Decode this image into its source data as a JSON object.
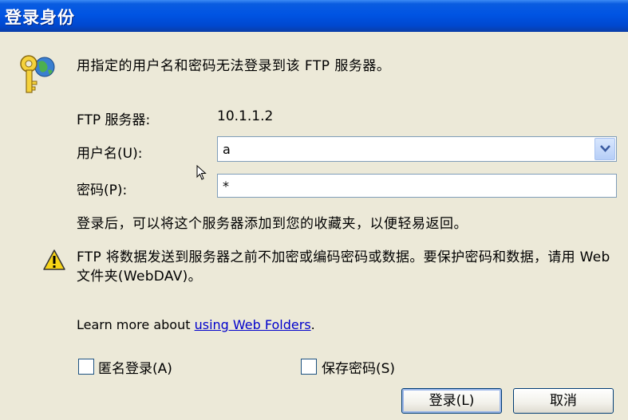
{
  "window": {
    "title": "登录身份"
  },
  "message": "用指定的用户名和密码无法登录到该 FTP 服务器。",
  "server": {
    "label": "FTP 服务器:",
    "value": "10.1.1.2"
  },
  "username": {
    "label": "用户名(U):",
    "value": "a"
  },
  "password": {
    "label": "密码(P):",
    "value": "*"
  },
  "info": "登录后，可以将这个服务器添加到您的收藏夹，以便轻易返回。",
  "warning": "FTP 将数据发送到服务器之前不加密或编码密码或数据。要保护密码和数据，请用 Web 文件夹(WebDAV)。",
  "learn_more": {
    "prefix": "Learn more about ",
    "link": "using Web Folders",
    "suffix": "."
  },
  "anonymous_checkbox": {
    "label": "匿名登录(A)",
    "checked": false
  },
  "save_password_checkbox": {
    "label": "保存密码(S)",
    "checked": false
  },
  "buttons": {
    "login": "登录(L)",
    "cancel": "取消"
  },
  "icons": {
    "key": "key-globe-icon",
    "warning": "warning-icon",
    "dropdown": "chevron-down-icon",
    "pointer": "mouse-pointer-icon"
  },
  "colors": {
    "titlebar": "#0054e3",
    "dialog_bg": "#ece9d8",
    "link": "#0000cc"
  }
}
